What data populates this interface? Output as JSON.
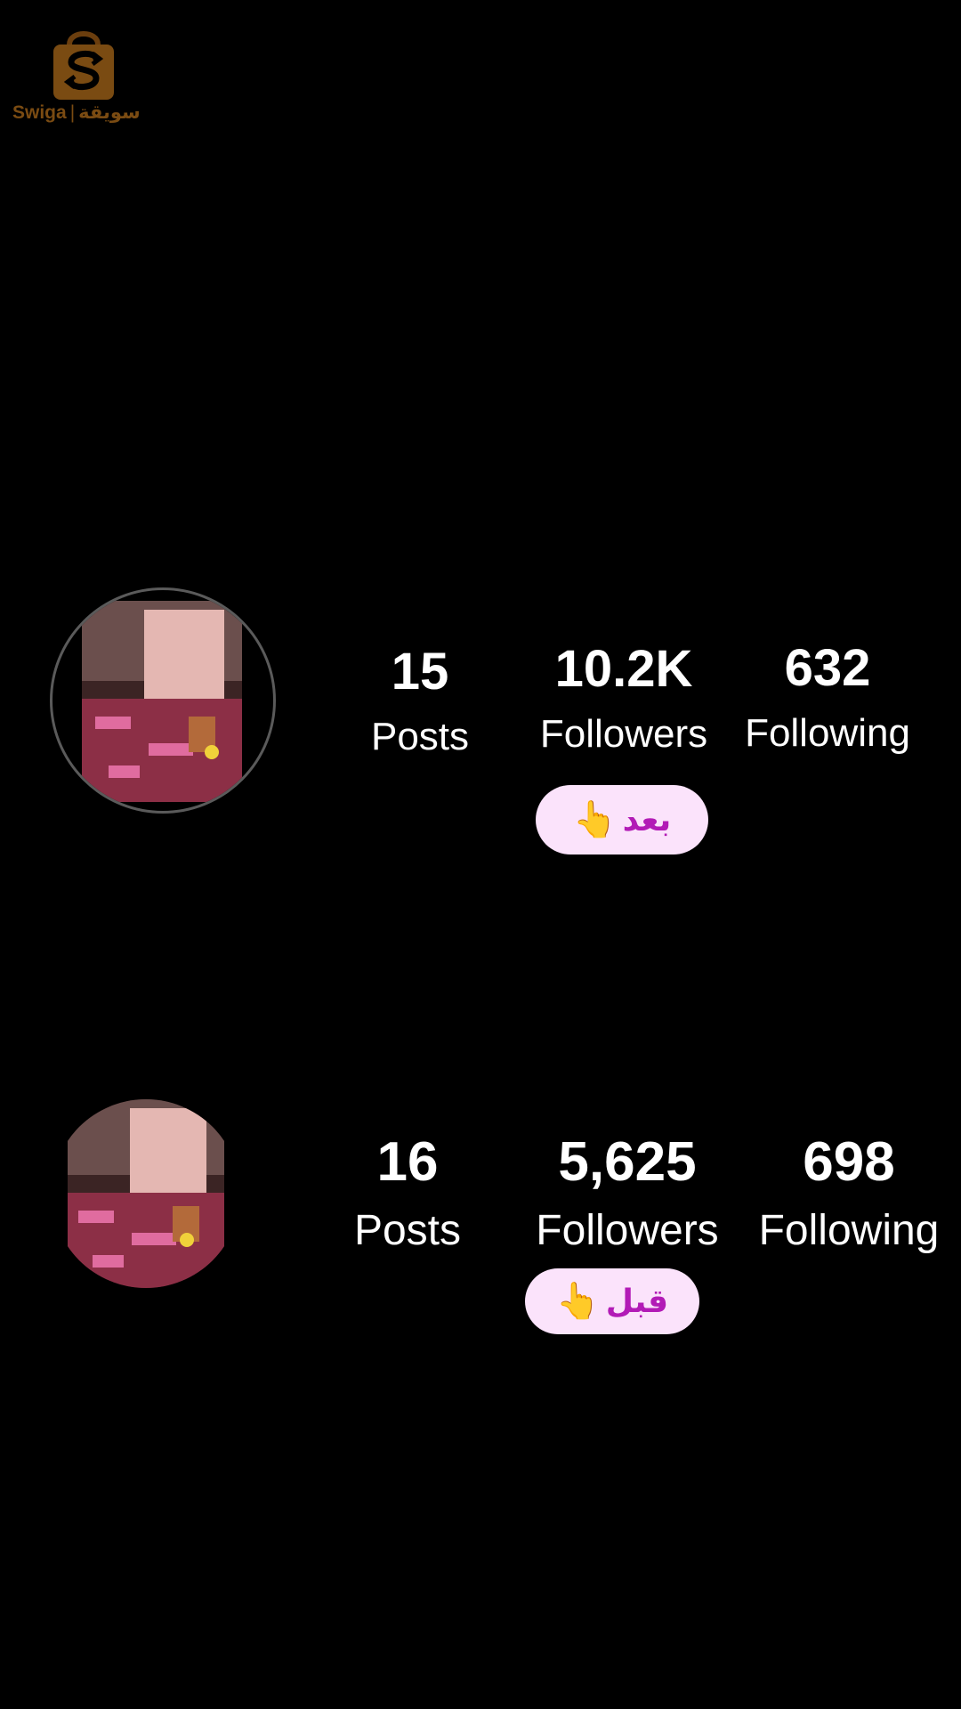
{
  "logo": {
    "brand_en": "Swiga",
    "separator": "|",
    "brand_ar": "سويقة",
    "color": "#7a4b12"
  },
  "after": {
    "posts_count": "15",
    "posts_label": "Posts",
    "followers_count": "10.2K",
    "followers_label": "Followers",
    "following_count": "632",
    "following_label": "Following",
    "badge_label": "بعد",
    "badge_icon": "pointing-hand-emoji"
  },
  "before": {
    "posts_count": "16",
    "posts_label": "Posts",
    "followers_count": "5,625",
    "followers_label": "Followers",
    "following_count": "698",
    "following_label": "Following",
    "badge_label": "قبل",
    "badge_icon": "pointing-hand-emoji"
  },
  "colors": {
    "background": "#000000",
    "text": "#ffffff",
    "badge_bg": "#fbe3fb",
    "badge_text": "#b21bb6"
  }
}
